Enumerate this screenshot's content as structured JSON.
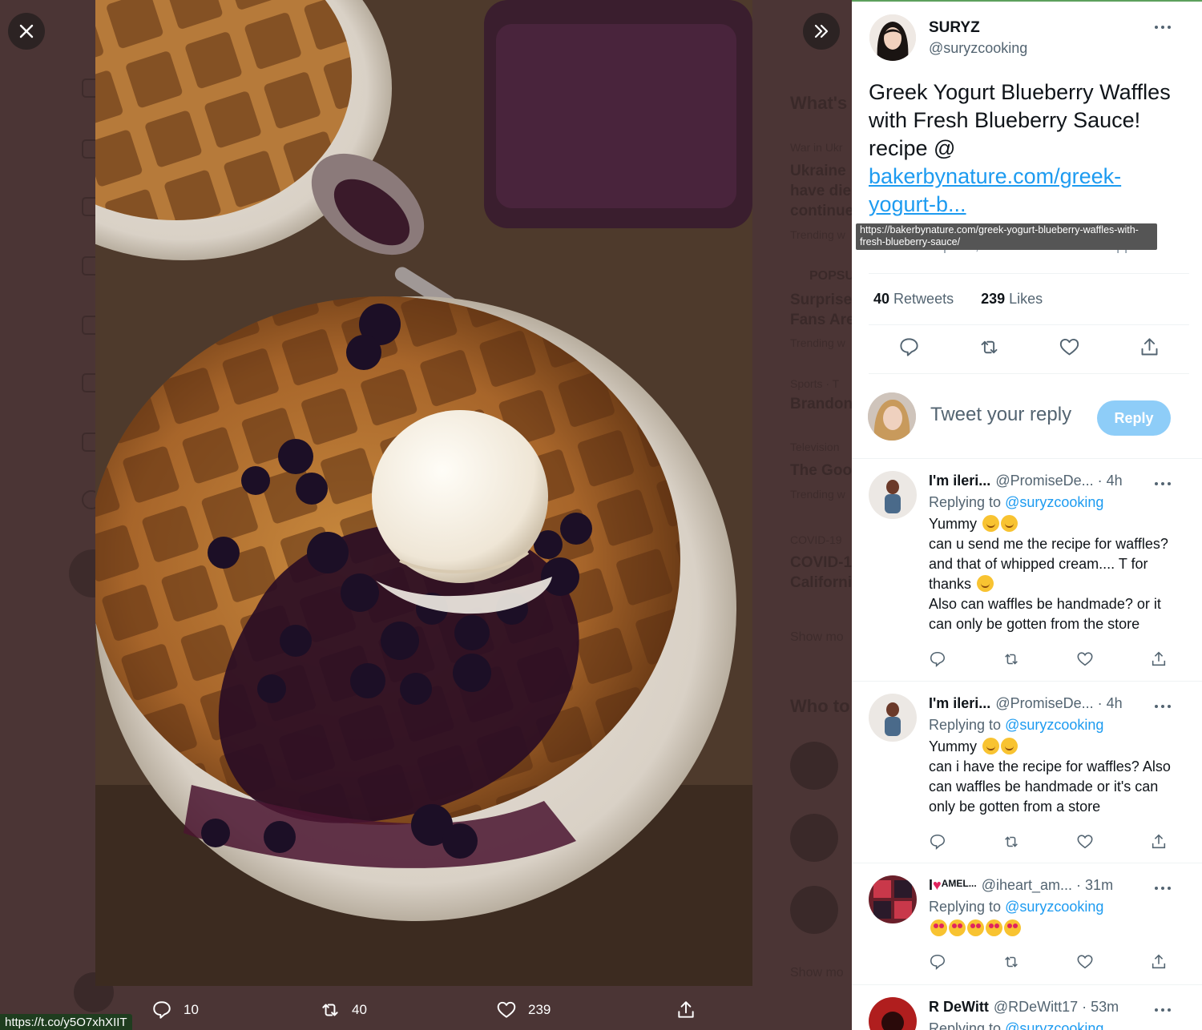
{
  "backdrop": {
    "whats_happening": "What's",
    "trend1_cat": "War in Ukr",
    "trend1_line1": "Ukraine",
    "trend1_line2": "have die",
    "trend1_line3": "continue",
    "trend1_meta": "Trending w",
    "trend2_cat": "POPSU",
    "trend2_line1": "Surprise",
    "trend2_line2": "Fans Are",
    "trend2_meta": "Trending w",
    "trend3_cat": "Sports · T",
    "trend3_line1": "Brandon",
    "trend4_cat": "Television",
    "trend4_line1": "The Goo",
    "trend4_meta": "Trending w",
    "trend5_cat": "COVID-19",
    "trend5_line1": "COVID-1",
    "trend5_line2": "Californi",
    "show_more_1": "Show mo",
    "who_to_follow": "Who to",
    "show_more_2": "Show mo"
  },
  "media": {
    "reply_count": "10",
    "retweet_count": "40",
    "like_count": "239"
  },
  "status_url": "https://t.co/y5O7xhXIIT",
  "tweet": {
    "author_name": "SURYZ",
    "author_handle": "@suryzcooking",
    "text_plain": "Greek Yogurt Blueberry Waffles with Fresh Blueberry Sauce! recipe @",
    "link_line1": "bakerbynature.com/greek-",
    "link_line2": "yogurt-b...",
    "link_tooltip": "https://bakerbynature.com/greek-yogurt-blueberry-waffles-with-fresh-blueberry-sauce/",
    "meta": "1:17 AM · Apr 11, 2022 · Twitter Web App",
    "retweets_num": "40",
    "retweets_label": "Retweets",
    "likes_num": "239",
    "likes_label": "Likes"
  },
  "compose": {
    "placeholder": "Tweet your reply",
    "reply_button": "Reply"
  },
  "replies": [
    {
      "name": "I'm ileri...",
      "handle": "@PromiseDe...",
      "time": "· 4h",
      "replying_prefix": "Replying to",
      "replying_to": "@suryzcooking",
      "line1": "Yummy",
      "line2": "can u send me the recipe for waffles? and that of whipped cream.... T for thanks",
      "line3": "Also can waffles be handmade? or it can only be gotten from the store"
    },
    {
      "name": "I'm ileri...",
      "handle": "@PromiseDe...",
      "time": "· 4h",
      "replying_prefix": "Replying to",
      "replying_to": "@suryzcooking",
      "line1": "Yummy",
      "line2": "can i have the recipe for waffles? Also can waffles be handmade or it's can only be gotten from a store"
    },
    {
      "name": "I",
      "name_suffix": "AMEL...",
      "handle": "@iheart_am...",
      "time": "· 31m",
      "replying_prefix": "Replying to",
      "replying_to": "@suryzcooking"
    },
    {
      "name": "R DeWitt",
      "handle": "@RDeWitt17",
      "time": "· 53m",
      "replying_prefix": "Replying to",
      "replying_to": "@suryzcooking"
    }
  ],
  "colors": {
    "accent": "#1d9bf0",
    "reply_button": "#8ecdf8",
    "backdrop": "#4b3535"
  }
}
